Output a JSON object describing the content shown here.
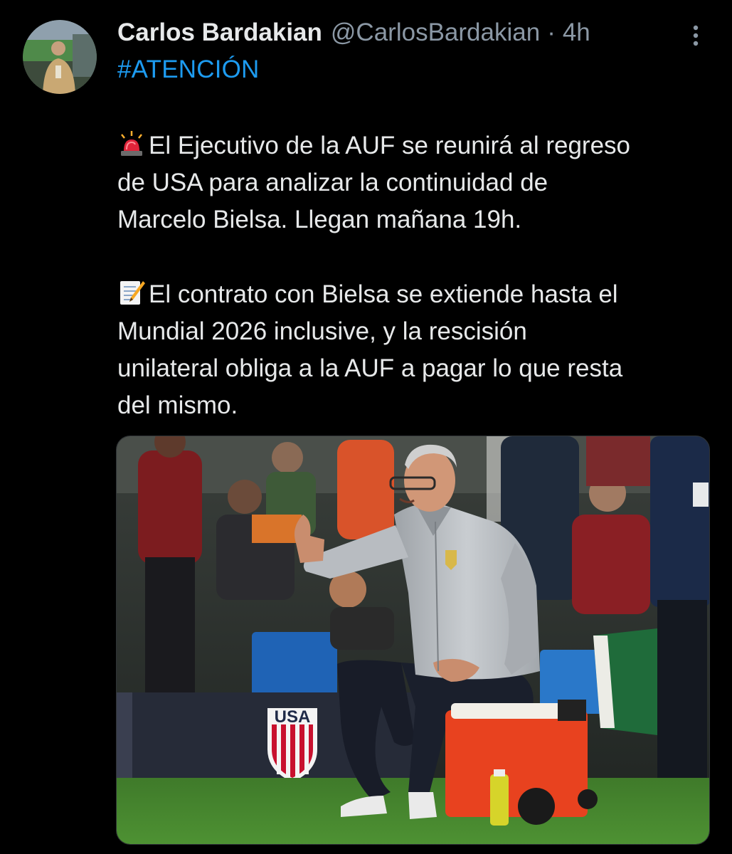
{
  "tweet": {
    "author": {
      "display_name": "Carlos Bardakian",
      "handle": "@CarlosBardakian",
      "separator": "·",
      "time": "4h",
      "avatar_icon": "profile-photo"
    },
    "more_icon": "more-vertical-icon",
    "hashtag": "#ATENCIÓN",
    "paragraphs": [
      {
        "emoji": "police-light-emoji",
        "lines": [
          "El Ejecutivo de la AUF se reunirá al regreso",
          "de USA para analizar la  continuidad de",
          "Marcelo Bielsa. Llegan mañana 19h."
        ]
      },
      {
        "emoji": "memo-emoji",
        "lines": [
          "El contrato con Bielsa se extiende hasta el",
          "Mundial 2026 inclusive, y la rescisión",
          "unilateral obliga a la AUF a pagar lo que resta",
          "del mismo."
        ]
      }
    ],
    "media": {
      "type": "photo",
      "banner_text": "USA"
    }
  },
  "colors": {
    "background": "#000000",
    "text": "#e7e9ea",
    "secondary": "#8b98a5",
    "link": "#1d9bf0"
  }
}
